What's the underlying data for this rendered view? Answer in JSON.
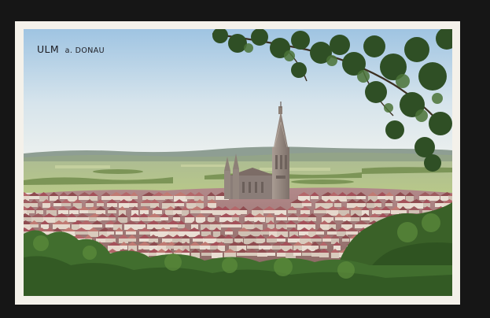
{
  "postcard": {
    "title_city": "ULM",
    "title_river": "a. DONAU"
  },
  "scene": {
    "subject": "cathedral-spire-over-old-town",
    "colors": {
      "sky_top": "#a7cbe6",
      "sky_bottom": "#eef2f2",
      "fields": "#b9c88f",
      "foliage": "#3e6a2c",
      "roofs": "#a5555a",
      "stone": "#9a8c83"
    }
  }
}
